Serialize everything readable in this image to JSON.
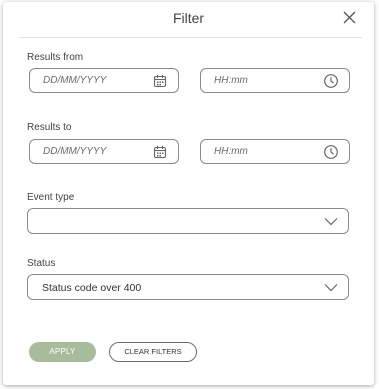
{
  "header": {
    "title": "Filter"
  },
  "results_from": {
    "label": "Results from",
    "date_placeholder": "DD/MM/YYYY",
    "time_placeholder": "HH:mm"
  },
  "results_to": {
    "label": "Results to",
    "date_placeholder": "DD/MM/YYYY",
    "time_placeholder": "HH:mm"
  },
  "event_type": {
    "label": "Event type",
    "value": ""
  },
  "status": {
    "label": "Status",
    "value": "Status code over 400"
  },
  "actions": {
    "apply_label": "APPLY",
    "clear_label": "CLEAR FILTERS"
  },
  "icons": {
    "close": "close-icon",
    "date": "calendar-icon",
    "time": "clock-icon",
    "dropdown": "chevron-down-icon"
  },
  "colors": {
    "apply_button": "#a7bc9a",
    "border": "#8a8a8a",
    "text": "#3d3d3d"
  }
}
